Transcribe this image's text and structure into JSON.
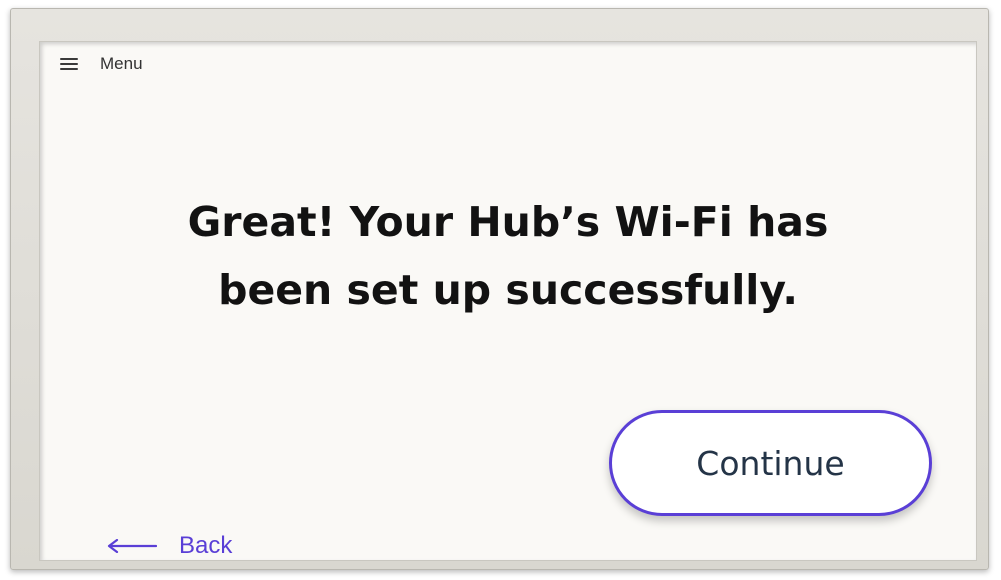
{
  "menu": {
    "icon": "hamburger-menu-icon",
    "label": "Menu"
  },
  "message": {
    "line1": "Great! Your Hub’s Wi-Fi has",
    "line2": "been set up successfully."
  },
  "actions": {
    "continue_label": "Continue",
    "back_label": "Back",
    "back_icon": "arrow-left-icon"
  },
  "colors": {
    "accent": "#5a3fd6",
    "headline": "#121212",
    "button_text": "#243447",
    "screen_bg": "#faf9f6",
    "bezel": "#dedcd6"
  }
}
